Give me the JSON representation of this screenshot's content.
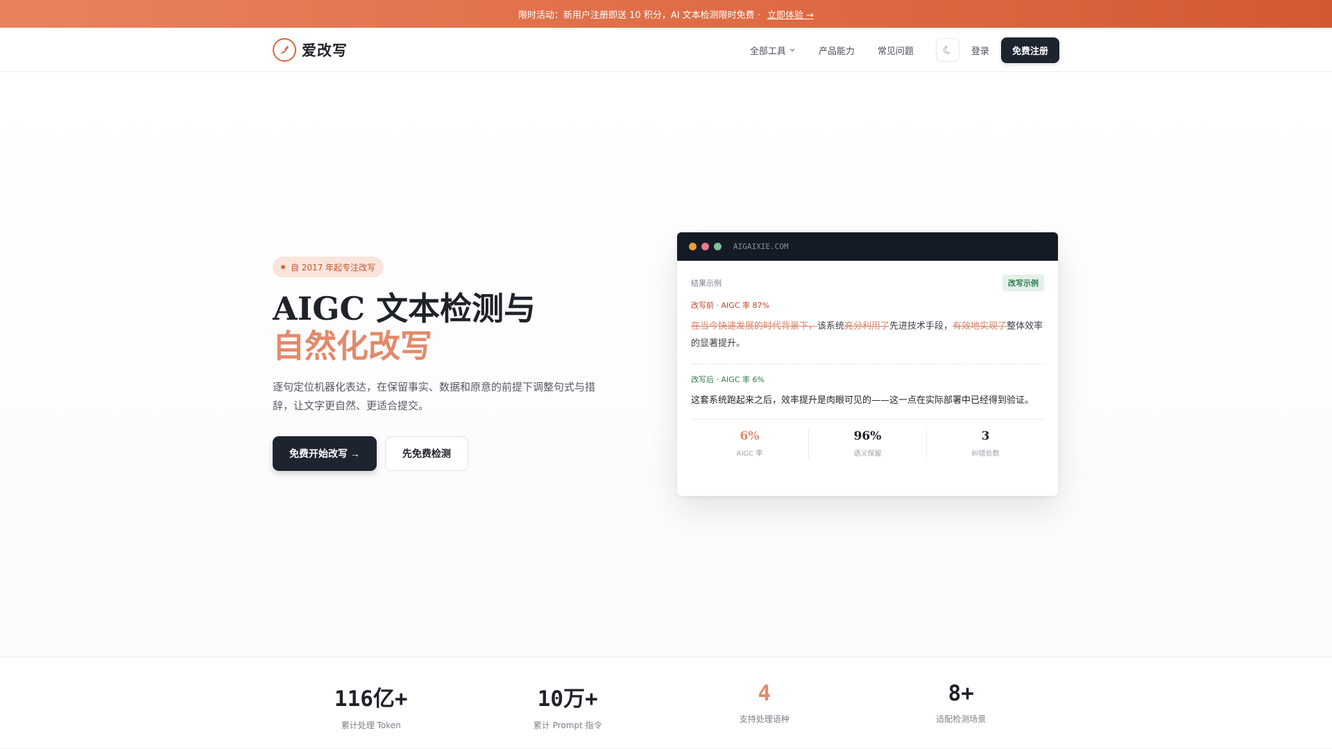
{
  "promo": {
    "text": "限时活动：新用户注册即送 10 积分，AI 文本检测限时免费 ·",
    "link": "立即体验 →"
  },
  "header": {
    "brand": "爱改写",
    "nav": [
      "全部工具",
      "产品能力",
      "常见问题"
    ],
    "login": "登录",
    "signup": "免费注册"
  },
  "hero": {
    "badge": "自 2017 年起专注改写",
    "title_line1": "AIGC 文本检测与",
    "title_line2": "自然化改写",
    "desc": "逐句定位机器化表达，在保留事实、数据和原意的前提下调整句式与措辞，让文字更自然、更适合提交。",
    "primary_button": "免费开始改写 →",
    "secondary_button": "先免费检测"
  },
  "demo_card": {
    "url": "AIGAIXIE.COM",
    "label": "结果示例",
    "tag": "改写示例",
    "before_label": "改写前 · AIGC 率 87%",
    "before_segments": [
      {
        "text": "在当今快速发展的时代背景下，",
        "struck": true
      },
      {
        "text": "该系统",
        "struck": false
      },
      {
        "text": "充分利用了",
        "struck": true
      },
      {
        "text": "先进技术手段，",
        "struck": false
      },
      {
        "text": "有效地实现了",
        "struck": true
      },
      {
        "text": "整体效率的显著提升。",
        "struck": false
      }
    ],
    "after_label": "改写后 · AIGC 率 6%",
    "after_text": "这套系统跑起来之后，效率提升是肉眼可见的——这一点在实际部署中已经得到验证。",
    "stats": [
      {
        "value": "6%",
        "label": "AIGC 率",
        "accent": true
      },
      {
        "value": "96%",
        "label": "语义保留",
        "accent": false
      },
      {
        "value": "3",
        "label": "纠错处数",
        "accent": false
      }
    ],
    "dot_colors": [
      "#e3a13b",
      "#e37c8c",
      "#7fbf9a"
    ]
  },
  "stats_strip": [
    {
      "value": "116亿+",
      "label": "累计处理 Token",
      "accent": false
    },
    {
      "value": "10万+",
      "label": "累计 Prompt 指令",
      "accent": false
    },
    {
      "value": "4",
      "label": "支持处理语种",
      "accent": true
    },
    {
      "value": "8+",
      "label": "适配检测场景",
      "accent": false
    }
  ],
  "colors": {
    "accent": "#d9653d",
    "dark": "#1c2430"
  }
}
